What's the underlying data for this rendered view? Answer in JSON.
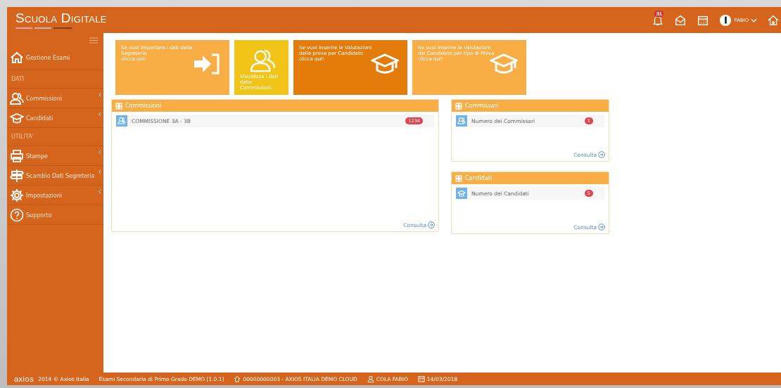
{
  "header": {
    "logo": "Scuola Digitale",
    "notifications": "31",
    "user": "FABIO"
  },
  "sidebar": {
    "items": [
      {
        "kind": "home",
        "label": "Gestione Esami",
        "submenu": false
      },
      {
        "kind": "section",
        "label": "DATI"
      },
      {
        "kind": "users",
        "label": "Commissioni",
        "submenu": true
      },
      {
        "kind": "cap",
        "label": "Candidati",
        "submenu": true
      },
      {
        "kind": "section",
        "label": "UTILITA'"
      },
      {
        "kind": "print",
        "label": "Stampe",
        "submenu": true
      },
      {
        "kind": "sign",
        "label": "Scambio Dati Segreteria",
        "submenu": true
      },
      {
        "kind": "gear",
        "label": "Impostazioni",
        "submenu": true
      },
      {
        "kind": "help",
        "label": "Supporto",
        "submenu": false
      }
    ]
  },
  "tiles": [
    {
      "kind": "import",
      "color": "#f9ad45",
      "lines": [
        "Se vuoi importare i dati della",
        "Segreteria",
        "clicca qui!"
      ]
    },
    {
      "kind": "users",
      "color": "#f2c417",
      "lines": [
        "Visualizza i dati",
        "delle",
        "Commissioni"
      ]
    },
    {
      "kind": "cap",
      "color": "#e47c0c",
      "lines": [
        "Se vuoi inserire le Valutazioni",
        "delle prove per Candidato",
        "clicca qui!"
      ]
    },
    {
      "kind": "cap",
      "color": "#f9ad45",
      "lines": [
        "Se vuoi inserire le Valutazioni",
        "dei Candidato per tipo di Prova",
        "clicca qui!"
      ]
    }
  ],
  "panels": [
    {
      "title": "Commissioni",
      "rows": [
        {
          "kind": "users",
          "label": "COMMISSIONE 3A - 3B",
          "badge": "1234"
        }
      ],
      "link": "Consulta"
    },
    {
      "title": "Commissari",
      "rows": [
        {
          "kind": "users",
          "label": "Numero dei Commissari",
          "badge": "1"
        }
      ],
      "link": "Consulta"
    },
    {
      "title": "Candidati",
      "rows": [
        {
          "kind": "cap",
          "label": "Numero dei Candidati",
          "badge": "5"
        }
      ],
      "link": "Consulta"
    }
  ],
  "footer": {
    "logo": "axios",
    "items": [
      {
        "kind": "text",
        "text": "2014 © Axios Italia"
      },
      {
        "kind": "text",
        "text": "Esami Secondaria di Primo Grado DEMO [1.0.1]"
      },
      {
        "kind": "home",
        "text": "00000000003 - AXIOS ITALIA DEMO CLOUD"
      },
      {
        "kind": "user",
        "text": "COLA FABIO"
      },
      {
        "kind": "calendar",
        "text": "14/03/2018"
      }
    ]
  }
}
